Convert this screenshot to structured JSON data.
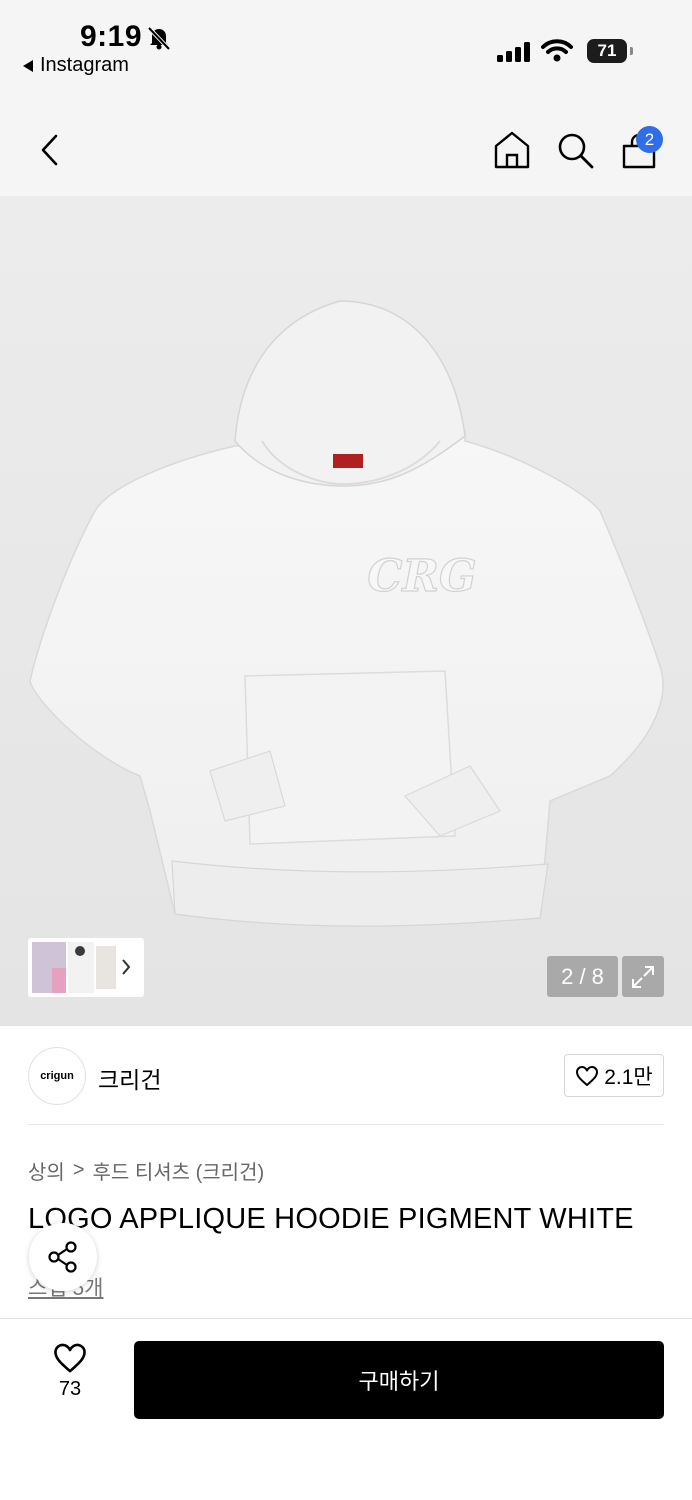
{
  "status_bar": {
    "time": "9:19",
    "back_app": "Instagram",
    "battery": "71",
    "icons": [
      "bell-mute-icon",
      "signal-icon",
      "wifi-icon",
      "battery-icon"
    ]
  },
  "nav": {
    "icons": [
      "back-chevron-icon",
      "home-icon",
      "search-icon",
      "cart-icon"
    ],
    "cart_badge": "2"
  },
  "gallery": {
    "image_description_icon": "hoodie-image",
    "counter": "2 / 8",
    "logo_text": "CRG"
  },
  "brand": {
    "logo_text": "crigun",
    "name": "크리건",
    "like_count": "2.1만"
  },
  "breadcrumb": {
    "level1": "상의",
    "separator": ">",
    "level2": "후드 티셔츠 (크리건)"
  },
  "product": {
    "title": "LOGO APPLIQUE HOODIE PIGMENT WHITE",
    "review_link": "스냅 5개"
  },
  "bottom_bar": {
    "heart_count": "73",
    "buy_label": "구매하기"
  },
  "colors": {
    "accent_badge": "#2f6ee6",
    "buy_button": "#000000"
  }
}
